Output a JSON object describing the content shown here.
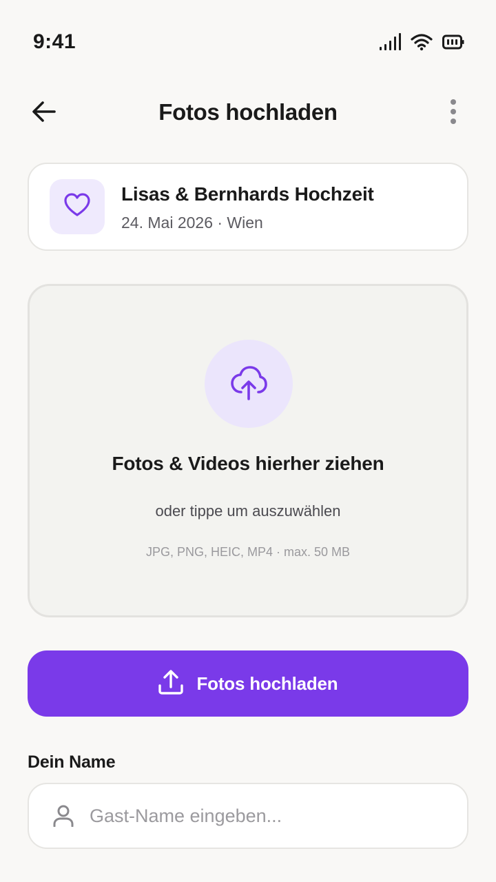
{
  "status_bar": {
    "time": "9:41",
    "icons": [
      "signal-icon",
      "wifi-icon",
      "battery-icon"
    ]
  },
  "header": {
    "title": "Fotos hochladen",
    "back_icon": "arrow-left-icon",
    "menu_icon": "more-vertical-icon"
  },
  "event": {
    "icon": "heart-icon",
    "title": "Lisas & Bernhards Hochzeit",
    "subtitle": "24. Mai 2026 · Wien"
  },
  "dropzone": {
    "icon": "cloud-upload-icon",
    "title": "Fotos & Videos hierher ziehen",
    "subtitle": "oder tippe um auszuwählen",
    "formats": "JPG, PNG, HEIC, MP4 · max. 50 MB"
  },
  "upload_button": {
    "icon": "upload-icon",
    "label": "Fotos hochladen"
  },
  "name_section": {
    "label": "Dein Name",
    "icon": "person-icon",
    "placeholder": "Gast-Name eingeben...",
    "value": ""
  },
  "colors": {
    "accent": "#7a3ae9",
    "accent_light": "#ebe5fc",
    "background": "#f9f8f6"
  }
}
